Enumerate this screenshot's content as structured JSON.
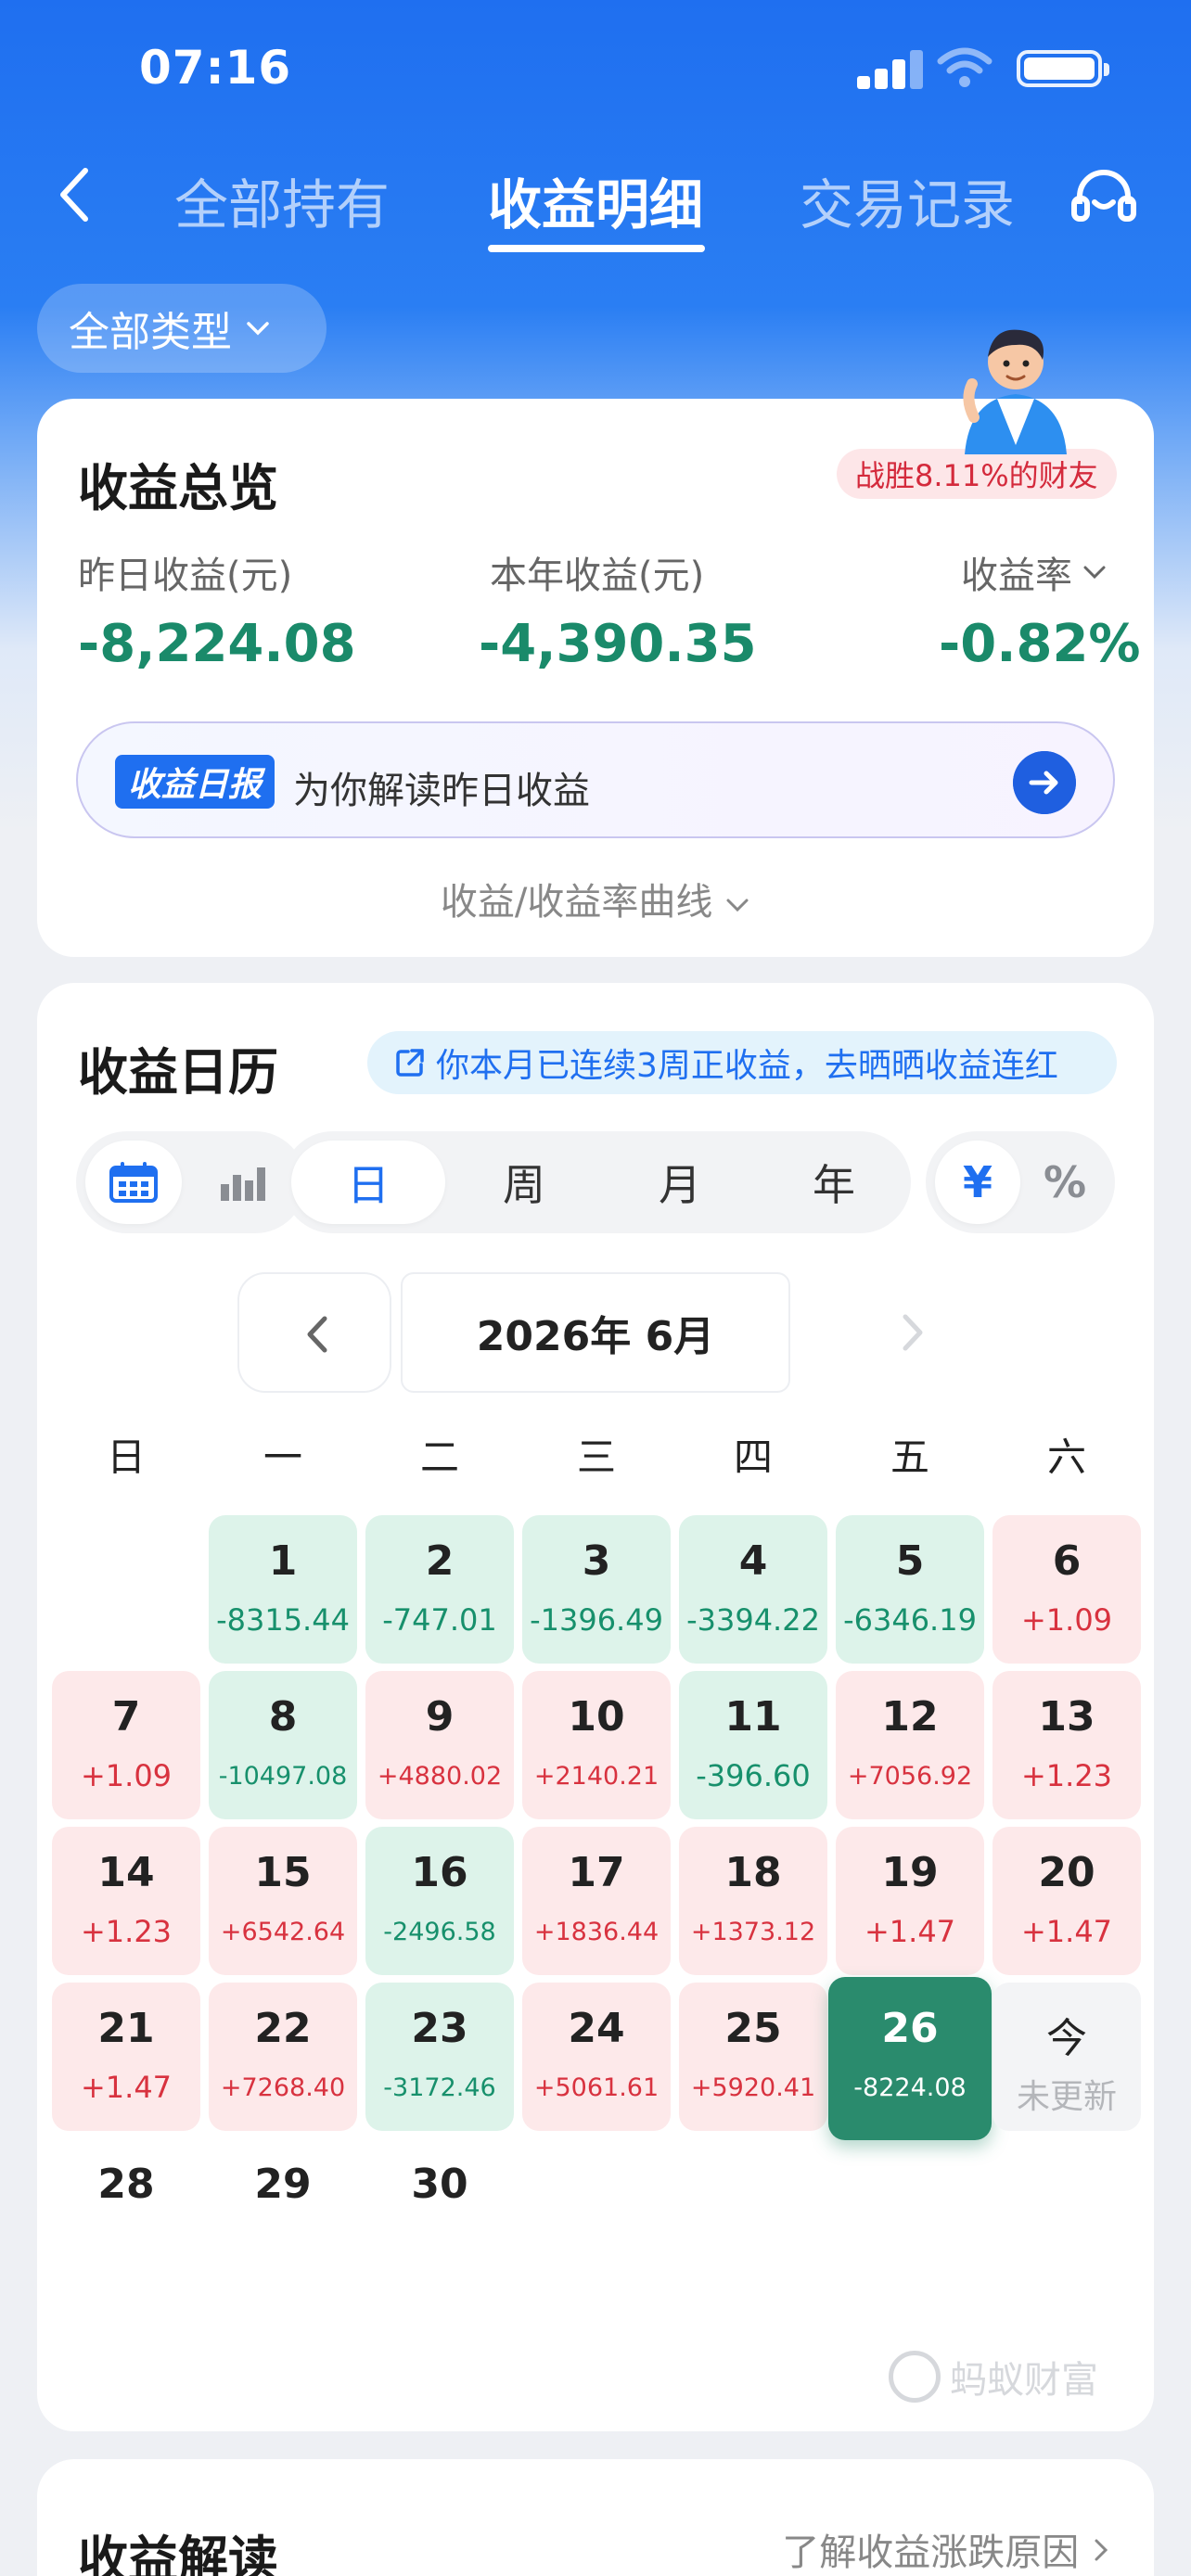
{
  "status_bar": {
    "time": "07:16"
  },
  "nav": {
    "tabs": [
      {
        "label": "全部持有"
      },
      {
        "label": "收益明细"
      },
      {
        "label": "交易记录"
      }
    ]
  },
  "filter": {
    "type_label": "全部类型"
  },
  "overview": {
    "title": "收益总览",
    "rank_badge": "战胜8.11%的财友",
    "metrics": [
      {
        "label": "昨日收益(元)",
        "value": "-8,224.08"
      },
      {
        "label": "本年收益(元)",
        "value": "-4,390.35"
      },
      {
        "label": "收益率",
        "value": "-0.82%"
      }
    ],
    "report_tag": "收益日报",
    "report_text": "为你解读昨日收益",
    "curve_toggle": "收益/收益率曲线"
  },
  "calendar": {
    "title": "收益日历",
    "streak_text": "你本月已连续3周正收益，去晒晒收益连红",
    "period_tabs": [
      "日",
      "周",
      "月",
      "年"
    ],
    "unit_tabs": [
      "¥",
      "%"
    ],
    "month_label": "2026年 6月",
    "weekdays": [
      "日",
      "一",
      "二",
      "三",
      "四",
      "五",
      "六"
    ],
    "days": [
      {
        "day": "1",
        "value": "-8315.44"
      },
      {
        "day": "2",
        "value": "-747.01"
      },
      {
        "day": "3",
        "value": "-1396.49"
      },
      {
        "day": "4",
        "value": "-3394.22"
      },
      {
        "day": "5",
        "value": "-6346.19"
      },
      {
        "day": "6",
        "value": "+1.09"
      },
      {
        "day": "7",
        "value": "+1.09"
      },
      {
        "day": "8",
        "value": "-10497.08"
      },
      {
        "day": "9",
        "value": "+4880.02"
      },
      {
        "day": "10",
        "value": "+2140.21"
      },
      {
        "day": "11",
        "value": "-396.60"
      },
      {
        "day": "12",
        "value": "+7056.92"
      },
      {
        "day": "13",
        "value": "+1.23"
      },
      {
        "day": "14",
        "value": "+1.23"
      },
      {
        "day": "15",
        "value": "+6542.64"
      },
      {
        "day": "16",
        "value": "-2496.58"
      },
      {
        "day": "17",
        "value": "+1836.44"
      },
      {
        "day": "18",
        "value": "+1373.12"
      },
      {
        "day": "19",
        "value": "+1.47"
      },
      {
        "day": "20",
        "value": "+1.47"
      },
      {
        "day": "21",
        "value": "+1.47"
      },
      {
        "day": "22",
        "value": "+7268.40"
      },
      {
        "day": "23",
        "value": "-3172.46"
      },
      {
        "day": "24",
        "value": "+5061.61"
      },
      {
        "day": "25",
        "value": "+5920.41"
      },
      {
        "day": "26",
        "value": "-8224.08"
      },
      {
        "day": "今",
        "value": "未更新"
      },
      {
        "day": "28",
        "value": ""
      },
      {
        "day": "29",
        "value": ""
      },
      {
        "day": "30",
        "value": ""
      }
    ],
    "watermark": "蚂蚁财富"
  },
  "interpretation": {
    "title": "收益解读",
    "link": "了解收益涨跌原因"
  },
  "colors": {
    "brand_blue": "#1f6ff0",
    "loss_green": "#17906c",
    "gain_red": "#d8323f",
    "selected_day": "#2a8b6d"
  }
}
